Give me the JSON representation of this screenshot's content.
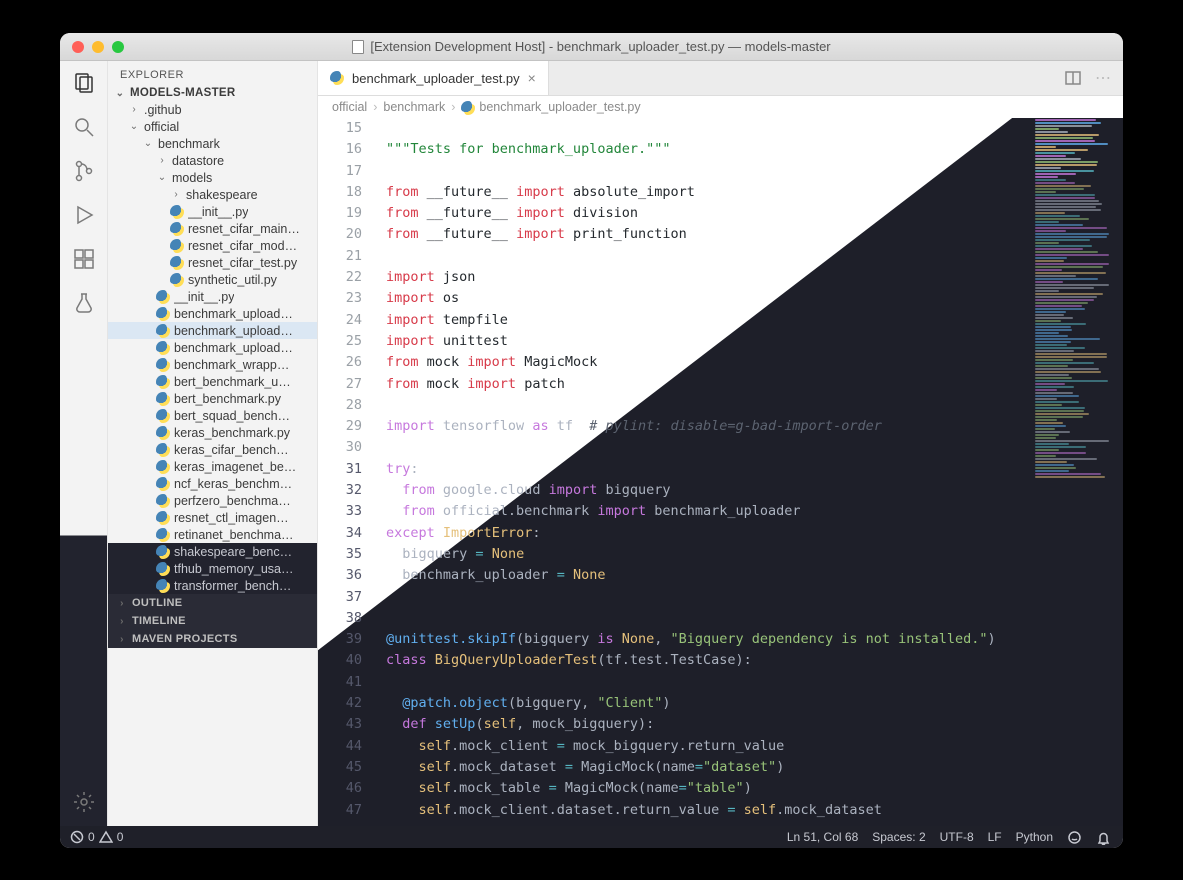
{
  "window": {
    "title": "[Extension Development Host] - benchmark_uploader_test.py — models-master"
  },
  "sidebar": {
    "header": "EXPLORER",
    "root": "MODELS-MASTER",
    "tree": [
      {
        "kind": "folder",
        "label": ".github",
        "depth": 1,
        "open": false
      },
      {
        "kind": "folder",
        "label": "official",
        "depth": 1,
        "open": true
      },
      {
        "kind": "folder",
        "label": "benchmark",
        "depth": 2,
        "open": true
      },
      {
        "kind": "folder",
        "label": "datastore",
        "depth": 3,
        "open": false
      },
      {
        "kind": "folder",
        "label": "models",
        "depth": 3,
        "open": true
      },
      {
        "kind": "folder",
        "label": "shakespeare",
        "depth": 4,
        "open": false
      },
      {
        "kind": "py",
        "label": "__init__.py",
        "depth": 4
      },
      {
        "kind": "py",
        "label": "resnet_cifar_main…",
        "depth": 4
      },
      {
        "kind": "py",
        "label": "resnet_cifar_mod…",
        "depth": 4
      },
      {
        "kind": "py",
        "label": "resnet_cifar_test.py",
        "depth": 4
      },
      {
        "kind": "py",
        "label": "synthetic_util.py",
        "depth": 4
      },
      {
        "kind": "py",
        "label": "__init__.py",
        "depth": 3
      },
      {
        "kind": "py",
        "label": "benchmark_upload…",
        "depth": 3
      },
      {
        "kind": "py",
        "label": "benchmark_upload…",
        "depth": 3,
        "selected": true
      },
      {
        "kind": "py",
        "label": "benchmark_upload…",
        "depth": 3
      },
      {
        "kind": "py",
        "label": "benchmark_wrapp…",
        "depth": 3
      },
      {
        "kind": "py",
        "label": "bert_benchmark_u…",
        "depth": 3
      },
      {
        "kind": "py",
        "label": "bert_benchmark.py",
        "depth": 3
      },
      {
        "kind": "py",
        "label": "bert_squad_bench…",
        "depth": 3
      },
      {
        "kind": "py",
        "label": "keras_benchmark.py",
        "depth": 3
      },
      {
        "kind": "py",
        "label": "keras_cifar_bench…",
        "depth": 3
      },
      {
        "kind": "py",
        "label": "keras_imagenet_be…",
        "depth": 3
      },
      {
        "kind": "py",
        "label": "ncf_keras_benchm…",
        "depth": 3
      },
      {
        "kind": "py",
        "label": "perfzero_benchma…",
        "depth": 3
      },
      {
        "kind": "py",
        "label": "resnet_ctl_imagen…",
        "depth": 3
      },
      {
        "kind": "py",
        "label": "retinanet_benchma…",
        "depth": 3
      },
      {
        "kind": "py",
        "label": "shakespeare_benc…",
        "depth": 3
      },
      {
        "kind": "py",
        "label": "tfhub_memory_usa…",
        "depth": 3
      },
      {
        "kind": "py",
        "label": "transformer_bench…",
        "depth": 3
      }
    ],
    "sections": [
      "OUTLINE",
      "TIMELINE",
      "MAVEN PROJECTS"
    ]
  },
  "tabs": {
    "open": [
      {
        "label": "benchmark_uploader_test.py"
      }
    ]
  },
  "breadcrumb": [
    "official",
    "benchmark",
    "benchmark_uploader_test.py"
  ],
  "editor": {
    "first_line": 15,
    "lines": [
      [],
      [
        {
          "t": "\"\"\"Tests for benchmark_uploader.\"\"\"",
          "c": "s"
        }
      ],
      [],
      [
        {
          "t": "from",
          "c": "kw"
        },
        {
          "t": " __future__ ",
          "c": "n"
        },
        {
          "t": "import",
          "c": "kw"
        },
        {
          "t": " absolute_import",
          "c": "n"
        }
      ],
      [
        {
          "t": "from",
          "c": "kw"
        },
        {
          "t": " __future__ ",
          "c": "n"
        },
        {
          "t": "import",
          "c": "kw"
        },
        {
          "t": " division",
          "c": "n"
        }
      ],
      [
        {
          "t": "from",
          "c": "kw"
        },
        {
          "t": " __future__ ",
          "c": "n"
        },
        {
          "t": "import",
          "c": "kw"
        },
        {
          "t": " print_function",
          "c": "n"
        }
      ],
      [],
      [
        {
          "t": "import",
          "c": "kw"
        },
        {
          "t": " json",
          "c": "n"
        }
      ],
      [
        {
          "t": "import",
          "c": "kw"
        },
        {
          "t": " os",
          "c": "n"
        }
      ],
      [
        {
          "t": "import",
          "c": "kw"
        },
        {
          "t": " tempfile",
          "c": "n"
        }
      ],
      [
        {
          "t": "import",
          "c": "kw"
        },
        {
          "t": " unittest",
          "c": "n"
        }
      ],
      [
        {
          "t": "from",
          "c": "kw"
        },
        {
          "t": " mock ",
          "c": "n"
        },
        {
          "t": "import",
          "c": "kw"
        },
        {
          "t": " MagicMock",
          "c": "n"
        }
      ],
      [
        {
          "t": "from",
          "c": "kw"
        },
        {
          "t": " mock ",
          "c": "n"
        },
        {
          "t": "import",
          "c": "kw"
        },
        {
          "t": " patch",
          "c": "n"
        }
      ],
      [],
      [
        {
          "t": "import",
          "c": "kw"
        },
        {
          "t": " tensorflow ",
          "c": "n"
        },
        {
          "t": "as",
          "c": "kw"
        },
        {
          "t": " tf  ",
          "c": "n"
        },
        {
          "t": "# pylint: disable=g-bad-import-order",
          "c": "c"
        }
      ],
      [],
      [
        {
          "t": "try",
          "c": "kw"
        },
        {
          "t": ":",
          "c": "n"
        }
      ],
      [
        {
          "t": "  ",
          "c": "n"
        },
        {
          "t": "from",
          "c": "kw"
        },
        {
          "t": " google.cloud ",
          "c": "n"
        },
        {
          "t": "import",
          "c": "kw"
        },
        {
          "t": " bigquery",
          "c": "n"
        }
      ],
      [
        {
          "t": "  ",
          "c": "n"
        },
        {
          "t": "from",
          "c": "kw"
        },
        {
          "t": " official.benchmark ",
          "c": "n"
        },
        {
          "t": "import",
          "c": "kw"
        },
        {
          "t": " benchmark_uploader",
          "c": "n"
        }
      ],
      [
        {
          "t": "except",
          "c": "kw"
        },
        {
          "t": " ",
          "c": "n"
        },
        {
          "t": "ImportError",
          "c": "d"
        },
        {
          "t": ":",
          "c": "n"
        }
      ],
      [
        {
          "t": "  bigquery ",
          "c": "n"
        },
        {
          "t": "=",
          "c": "op"
        },
        {
          "t": " ",
          "c": "n"
        },
        {
          "t": "None",
          "c": "d"
        }
      ],
      [
        {
          "t": "  benchmark_uploader ",
          "c": "n"
        },
        {
          "t": "=",
          "c": "op"
        },
        {
          "t": " ",
          "c": "n"
        },
        {
          "t": "None",
          "c": "d"
        }
      ],
      [],
      [],
      [
        {
          "t": "@unittest.skipIf",
          "c": "f"
        },
        {
          "t": "(bigquery ",
          "c": "n"
        },
        {
          "t": "is",
          "c": "kw"
        },
        {
          "t": " ",
          "c": "n"
        },
        {
          "t": "None",
          "c": "d"
        },
        {
          "t": ", ",
          "c": "n"
        },
        {
          "t": "\"Bigquery dependency is not installed.\"",
          "c": "s"
        },
        {
          "t": ")",
          "c": "n"
        }
      ],
      [
        {
          "t": "class",
          "c": "kw"
        },
        {
          "t": " ",
          "c": "n"
        },
        {
          "t": "BigQueryUploaderTest",
          "c": "d"
        },
        {
          "t": "(tf.test.TestCase):",
          "c": "n"
        }
      ],
      [],
      [
        {
          "t": "  ",
          "c": "n"
        },
        {
          "t": "@patch.object",
          "c": "f"
        },
        {
          "t": "(bigquery, ",
          "c": "n"
        },
        {
          "t": "\"Client\"",
          "c": "s"
        },
        {
          "t": ")",
          "c": "n"
        }
      ],
      [
        {
          "t": "  ",
          "c": "n"
        },
        {
          "t": "def",
          "c": "kw"
        },
        {
          "t": " ",
          "c": "n"
        },
        {
          "t": "setUp",
          "c": "f"
        },
        {
          "t": "(",
          "c": "n"
        },
        {
          "t": "self",
          "c": "d"
        },
        {
          "t": ", mock_bigquery):",
          "c": "n"
        }
      ],
      [
        {
          "t": "    ",
          "c": "n"
        },
        {
          "t": "self",
          "c": "d"
        },
        {
          "t": ".mock_client ",
          "c": "n"
        },
        {
          "t": "=",
          "c": "op"
        },
        {
          "t": " mock_bigquery.return_value",
          "c": "n"
        }
      ],
      [
        {
          "t": "    ",
          "c": "n"
        },
        {
          "t": "self",
          "c": "d"
        },
        {
          "t": ".mock_dataset ",
          "c": "n"
        },
        {
          "t": "=",
          "c": "op"
        },
        {
          "t": " MagicMock(name",
          "c": "n"
        },
        {
          "t": "=",
          "c": "op"
        },
        {
          "t": "\"dataset\"",
          "c": "s"
        },
        {
          "t": ")",
          "c": "n"
        }
      ],
      [
        {
          "t": "    ",
          "c": "n"
        },
        {
          "t": "self",
          "c": "d"
        },
        {
          "t": ".mock_table ",
          "c": "n"
        },
        {
          "t": "=",
          "c": "op"
        },
        {
          "t": " MagicMock(name",
          "c": "n"
        },
        {
          "t": "=",
          "c": "op"
        },
        {
          "t": "\"table\"",
          "c": "s"
        },
        {
          "t": ")",
          "c": "n"
        }
      ],
      [
        {
          "t": "    ",
          "c": "n"
        },
        {
          "t": "self",
          "c": "d"
        },
        {
          "t": ".mock_client.dataset.return_value ",
          "c": "n"
        },
        {
          "t": "=",
          "c": "op"
        },
        {
          "t": " ",
          "c": "n"
        },
        {
          "t": "self",
          "c": "d"
        },
        {
          "t": ".mock_dataset",
          "c": "n"
        }
      ]
    ]
  },
  "status": {
    "errors": "0",
    "warnings": "0",
    "cursor": "Ln 51, Col 68",
    "spaces": "Spaces: 2",
    "encoding": "UTF-8",
    "eol": "LF",
    "lang": "Python"
  }
}
